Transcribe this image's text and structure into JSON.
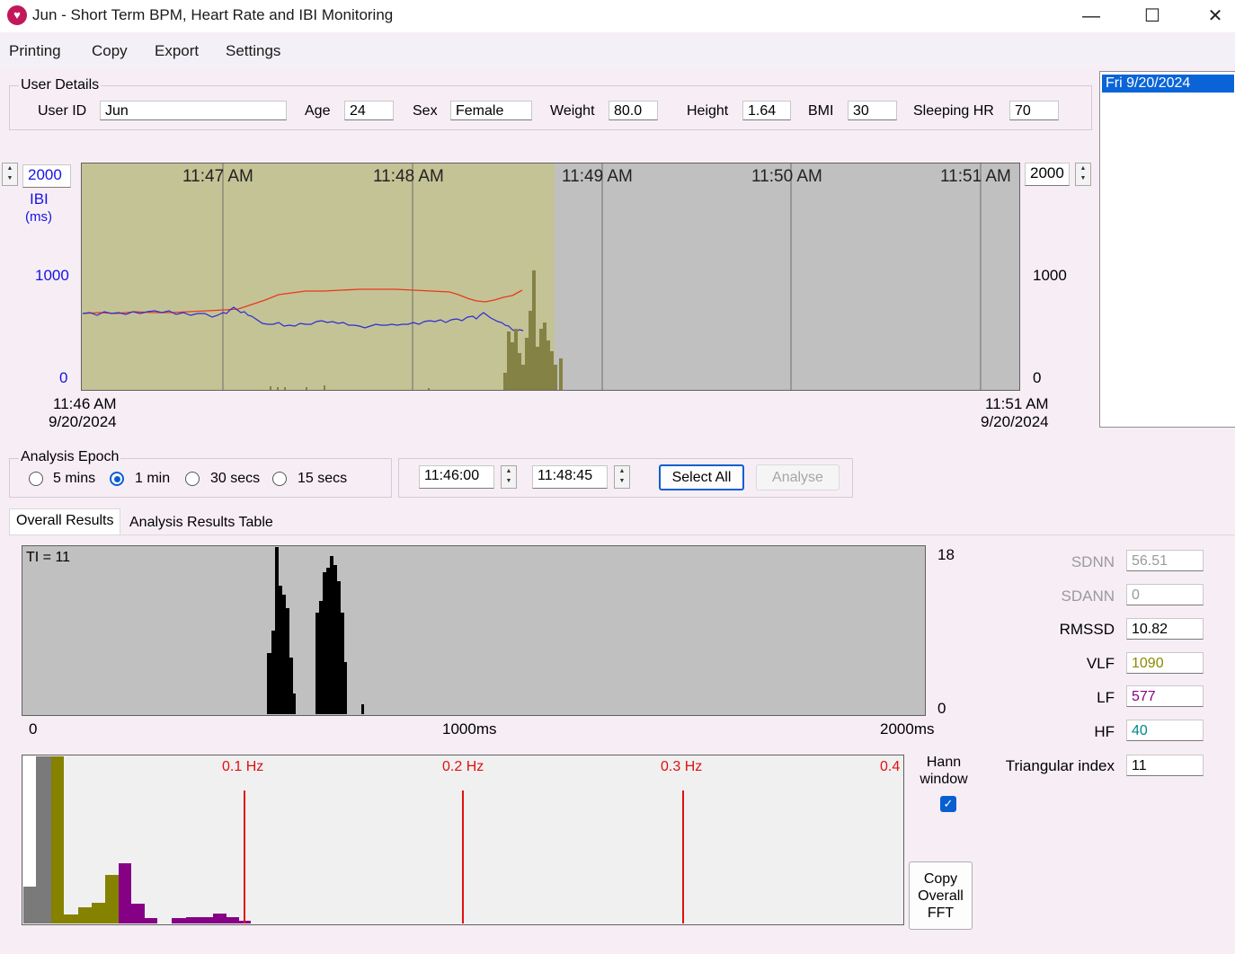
{
  "window": {
    "title": "Jun - Short Term BPM, Heart Rate and IBI Monitoring",
    "app_icon": "heart-icon",
    "minimize": "—",
    "maximize": "☐",
    "close": "✕"
  },
  "menu": [
    "Printing",
    "Copy",
    "Export",
    "Settings"
  ],
  "user_details": {
    "group_label": "User Details",
    "user_id": {
      "label": "User ID",
      "value": "Jun"
    },
    "age": {
      "label": "Age",
      "value": "24"
    },
    "sex": {
      "label": "Sex",
      "value": "Female"
    },
    "weight": {
      "label": "Weight",
      "value": "80.0"
    },
    "height": {
      "label": "Height",
      "value": "1.64"
    },
    "bmi": {
      "label": "BMI",
      "value": "30"
    },
    "sleeping_hr": {
      "label": "Sleeping HR",
      "value": "70"
    }
  },
  "sessions": {
    "selected": "Fri 9/20/2024"
  },
  "ibi_chart": {
    "left_max_value": "2000",
    "right_max_value": "2000",
    "axis_label": "IBI",
    "axis_unit": "(ms)",
    "left_ticks": [
      "1000",
      "0"
    ],
    "right_ticks": [
      "1000",
      "0"
    ],
    "time_labels": [
      "11:47 AM",
      "11:48 AM",
      "11:49 AM",
      "11:50 AM",
      "11:51 AM"
    ],
    "start_time": "11:46 AM",
    "start_date": "9/20/2024",
    "end_time": "11:51 AM",
    "end_date": "9/20/2024",
    "colors": {
      "selected_bg": "#c4c396",
      "unselected_bg": "#c0c0c0",
      "bpm_line": "#e83a1c",
      "ibi_line": "#2b2bd6",
      "histogram": "#858245"
    }
  },
  "analysis_epoch": {
    "label": "Analysis Epoch",
    "options": [
      "5 mins",
      "1 min",
      "30 secs",
      "15 secs"
    ],
    "selected": "1 min",
    "start_time": "11:46:00",
    "end_time": "11:48:45",
    "select_all": "Select All",
    "analyse": "Analyse"
  },
  "tabs": [
    "Overall Results",
    "Analysis Results Table"
  ],
  "active_tab": "Overall Results",
  "histogram": {
    "ti_label": "TI = 11",
    "y_max": "18",
    "y_min": "0",
    "x_labels": [
      "0",
      "1000ms",
      "2000ms"
    ]
  },
  "stats": [
    {
      "label": "SDNN",
      "value": "56.51",
      "label_color": "#9a9a9a",
      "value_color": "#9a9a9a"
    },
    {
      "label": "SDANN",
      "value": "0",
      "label_color": "#9a9a9a",
      "value_color": "#9a9a9a"
    },
    {
      "label": "RMSSD",
      "value": "10.82",
      "label_color": "#000000",
      "value_color": "#000000"
    },
    {
      "label": "VLF",
      "value": "1090",
      "label_color": "#000000",
      "value_color": "#8a8a00"
    },
    {
      "label": "LF",
      "value": "577",
      "label_color": "#000000",
      "value_color": "#8a008a"
    },
    {
      "label": "HF",
      "value": "40",
      "label_color": "#000000",
      "value_color": "#00888a"
    },
    {
      "label": "Triangular index",
      "value": "11",
      "label_color": "#000000",
      "value_color": "#000000"
    }
  ],
  "fft": {
    "freq_labels": [
      "0.1 Hz",
      "0.2 Hz",
      "0.3 Hz",
      "0.4"
    ],
    "hann_label": "Hann window",
    "hann_checked": true,
    "copy_button": "Copy Overall FFT"
  }
}
